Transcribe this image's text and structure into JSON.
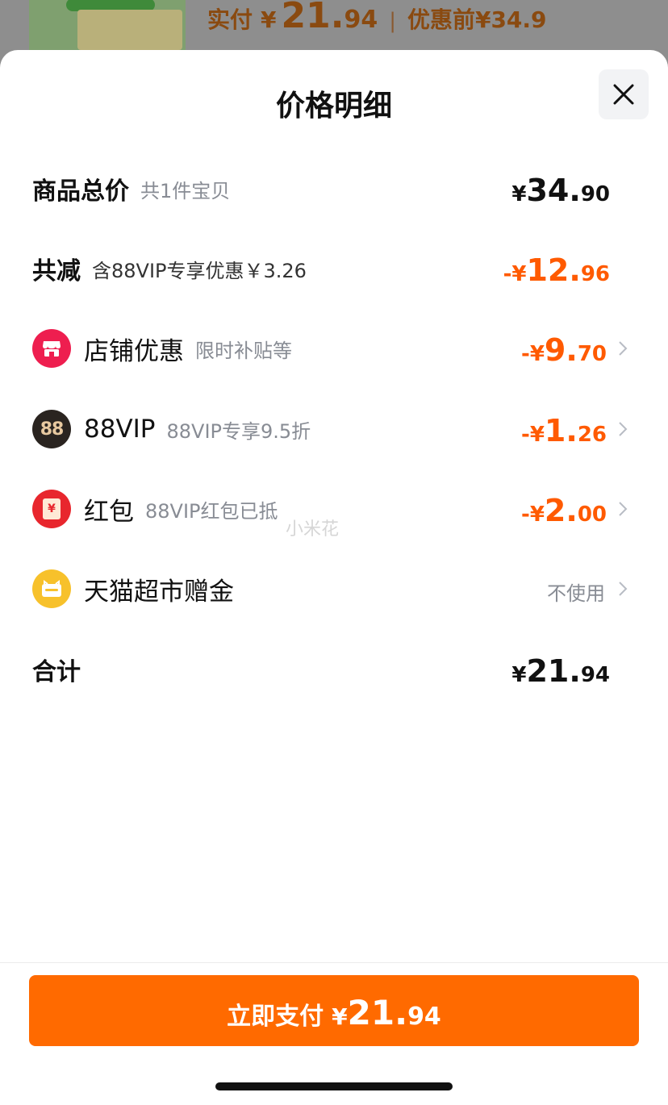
{
  "background": {
    "paid_label": "实付",
    "currency": "¥",
    "paid_int": "21.",
    "paid_dec": "94",
    "separator": "|",
    "original_label": "优惠前¥34.9"
  },
  "sheet": {
    "title": "价格明细",
    "close_icon": "close-icon"
  },
  "rows": {
    "total": {
      "label": "商品总价",
      "sub": "共1件宝贝",
      "cur": "¥",
      "int": "34.",
      "dec": "90"
    },
    "discount": {
      "label": "共减",
      "sub": "含88VIP专享优惠￥3.26",
      "cur": "-¥",
      "int": "12.",
      "dec": "96"
    },
    "shop": {
      "label": "店铺优惠",
      "sub": "限时补贴等",
      "cur": "-¥",
      "int": "9.",
      "dec": "70",
      "icon": "store-icon"
    },
    "vip": {
      "label": "88VIP",
      "sub": "88VIP专享9.5折",
      "cur": "-¥",
      "int": "1.",
      "dec": "26",
      "icon_text": "88"
    },
    "redpacket": {
      "label": "红包",
      "sub": "88VIP红包已抵",
      "cur": "-¥",
      "int": "2.",
      "dec": "00",
      "icon_text": "¥"
    },
    "gift": {
      "label": "天猫超市赠金",
      "value": "不使用",
      "icon": "wallet-icon"
    },
    "sum": {
      "label": "合计",
      "cur": "¥",
      "int": "21.",
      "dec": "94"
    }
  },
  "watermark": "小米花",
  "pay_button": {
    "label": "立即支付",
    "cur": "¥",
    "int": "21.",
    "dec": "94"
  },
  "colors": {
    "accent": "#ff6a00",
    "discount": "#ff5a00",
    "shop_icon": "#ee1e4f",
    "vip_icon": "#2a2420",
    "redpacket_icon": "#e8262d",
    "gift_icon": "#f7c12b"
  }
}
